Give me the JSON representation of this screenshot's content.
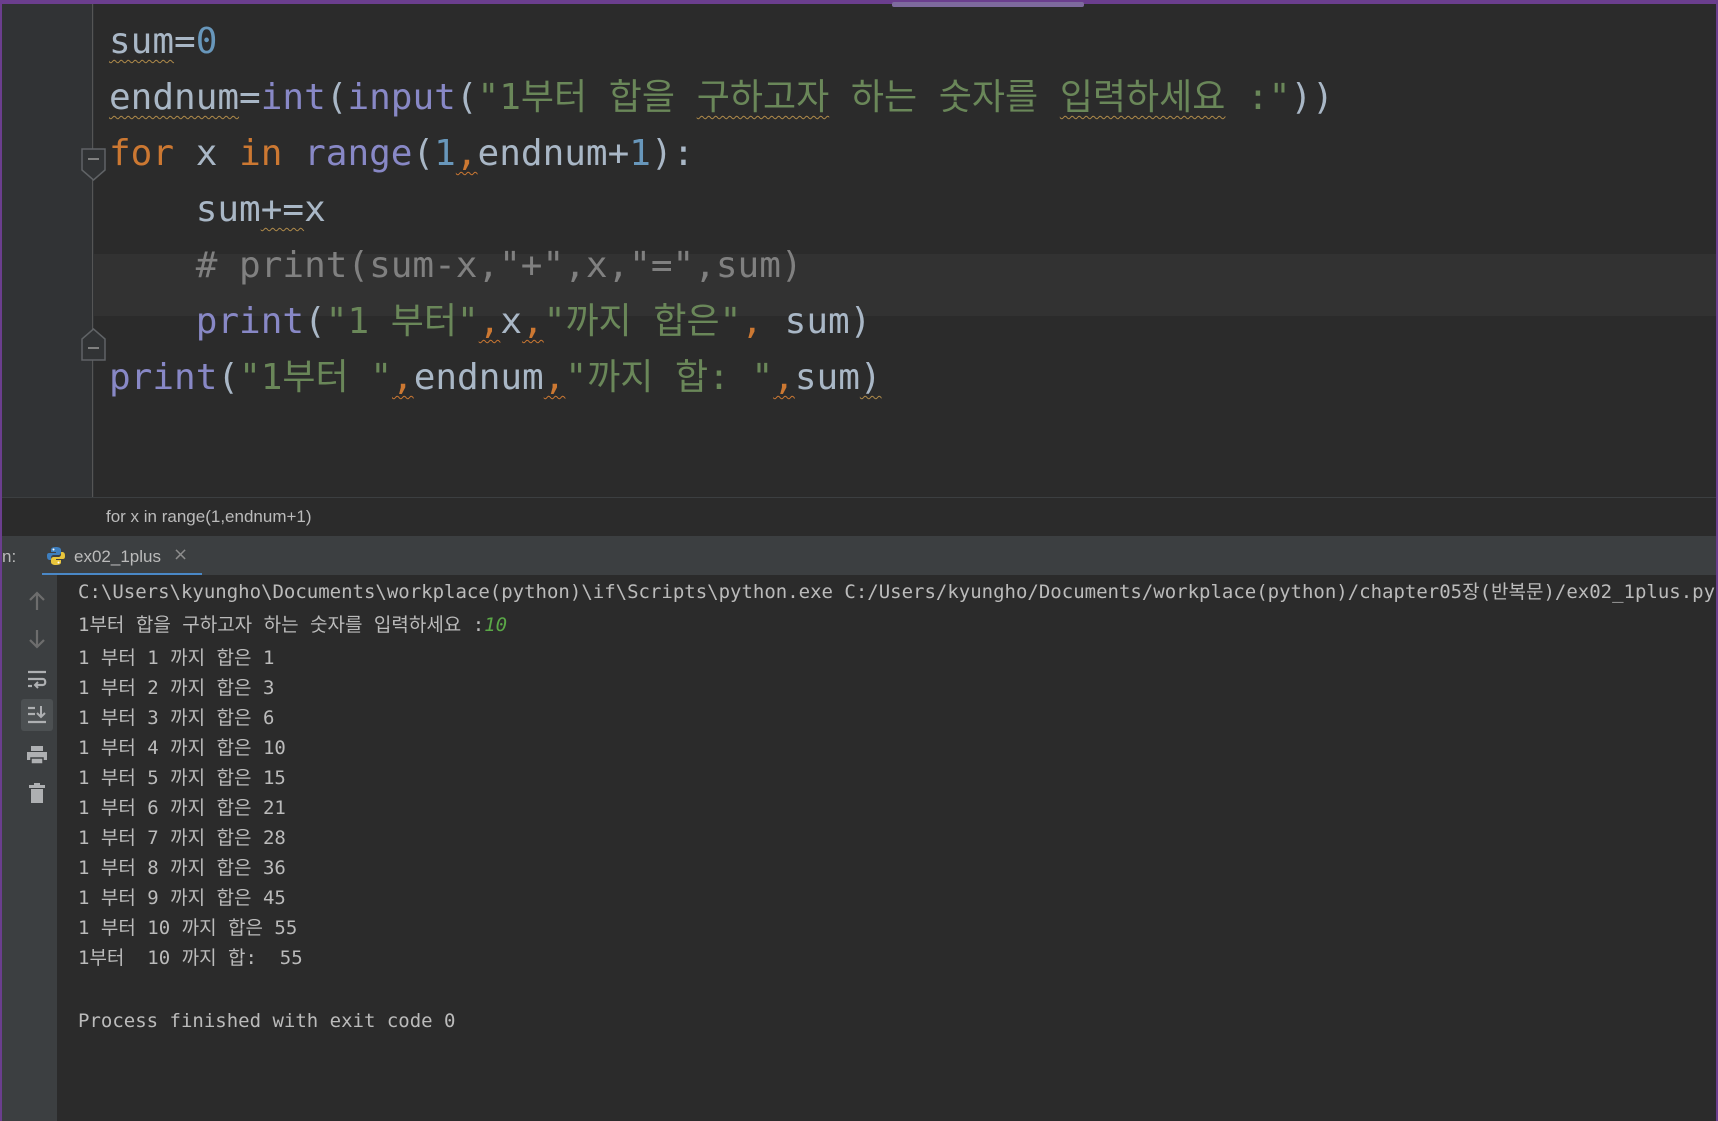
{
  "editor": {
    "lines": [
      {
        "parts": [
          [
            "sum",
            "wavy"
          ],
          [
            "=",
            ""
          ],
          [
            "0",
            "num"
          ]
        ]
      },
      {
        "parts": [
          [
            "endnum",
            "wavy"
          ],
          [
            "=",
            ""
          ],
          [
            "int",
            "fn"
          ],
          [
            "(",
            ""
          ],
          [
            "input",
            "fn"
          ],
          [
            "(",
            ""
          ],
          [
            "\"1부터 합을 ",
            "str"
          ],
          [
            "구하고자",
            "str wavy"
          ],
          [
            " 하는 숫자를 ",
            "str"
          ],
          [
            "입력하세요",
            "str wavy"
          ],
          [
            " :\"",
            "str"
          ],
          [
            "))",
            ""
          ]
        ]
      },
      {
        "parts": [
          [
            "for",
            "kw"
          ],
          [
            " x ",
            ""
          ],
          [
            "in",
            "kw"
          ],
          [
            " ",
            ""
          ],
          [
            "range",
            "fn"
          ],
          [
            "(",
            ""
          ],
          [
            "1",
            "num"
          ],
          [
            ",",
            "kw wavy-o"
          ],
          [
            "endnum",
            ""
          ],
          [
            "+",
            ""
          ],
          [
            "1",
            "num"
          ],
          [
            "):",
            ""
          ]
        ]
      },
      {
        "parts": [
          [
            "    sum",
            ""
          ],
          [
            "+=",
            "wavy"
          ],
          [
            "x",
            ""
          ]
        ]
      },
      {
        "parts": [
          [
            "    # print(sum-x,\"+\",x,\"=\",sum)",
            "cmt"
          ]
        ]
      },
      {
        "parts": [
          [
            "    ",
            ""
          ],
          [
            "print",
            "fn"
          ],
          [
            "(",
            ""
          ],
          [
            "\"1 부터\"",
            "str"
          ],
          [
            ",",
            "kw wavy-o"
          ],
          [
            "x",
            ""
          ],
          [
            ",",
            "kw wavy-o"
          ],
          [
            "\"까지 합은\"",
            "str"
          ],
          [
            ",",
            "kw"
          ],
          [
            " sum)",
            ""
          ]
        ]
      },
      {
        "parts": [
          [
            "print",
            "fn"
          ],
          [
            "(",
            ""
          ],
          [
            "\"1부터 \"",
            "str"
          ],
          [
            ",",
            "kw wavy-o"
          ],
          [
            "endnum",
            ""
          ],
          [
            ",",
            "kw wavy-o"
          ],
          [
            "\"까지 합: \"",
            "str"
          ],
          [
            ",",
            "kw wavy-o"
          ],
          [
            "sum",
            ""
          ],
          [
            ")",
            "wavy"
          ]
        ]
      }
    ]
  },
  "breadcrumb": {
    "text": "for x in range(1,endnum+1)"
  },
  "run": {
    "label": "n:",
    "tab_label": "ex02_1plus",
    "tab_close": "×"
  },
  "console": {
    "command": "C:\\Users\\kyungho\\Documents\\workplace(python)\\if\\Scripts\\python.exe C:/Users/kyungho/Documents/workplace(python)/chapter05장(반복문)/ex02_1plus.py",
    "prompt": "1부터 합을 구하고자 하는 숫자를 입력하세요 :",
    "user_input": "10",
    "output": [
      "1 부터 1 까지 합은 1",
      "1 부터 2 까지 합은 3",
      "1 부터 3 까지 합은 6",
      "1 부터 4 까지 합은 10",
      "1 부터 5 까지 합은 15",
      "1 부터 6 까지 합은 21",
      "1 부터 7 까지 합은 28",
      "1 부터 8 까지 합은 36",
      "1 부터 9 까지 합은 45",
      "1 부터 10 까지 합은 55",
      "1부터  10 까지 합:  55"
    ],
    "blank": "",
    "finished": "Process finished with exit code 0"
  },
  "colors": {
    "background": "#2b2b2b",
    "keyword": "#cc7832",
    "builtin": "#8888c6",
    "number": "#6897bb",
    "string": "#6a8759",
    "comment": "#808080",
    "input": "#5aa847",
    "window_border": "#6b3e8e"
  },
  "icons": [
    "fold-icon",
    "python-file-icon",
    "up-arrow-icon",
    "down-arrow-icon",
    "soft-wrap-icon",
    "scroll-to-end-icon",
    "print-icon",
    "trash-icon"
  ]
}
